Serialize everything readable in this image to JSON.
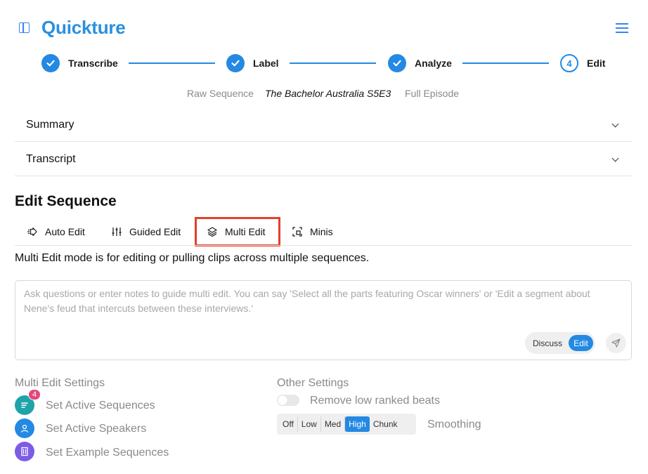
{
  "app": {
    "title": "Quickture"
  },
  "stepper": {
    "steps": [
      {
        "label": "Transcribe",
        "state": "complete"
      },
      {
        "label": "Label",
        "state": "complete"
      },
      {
        "label": "Analyze",
        "state": "complete"
      },
      {
        "label": "Edit",
        "state": "current",
        "number": "4"
      }
    ]
  },
  "breadcrumb": {
    "type": "Raw Sequence",
    "title": "The Bachelor Australia S5E3",
    "scope": "Full Episode"
  },
  "accordions": {
    "summary": "Summary",
    "transcript": "Transcript"
  },
  "edit_sequence": {
    "title": "Edit Sequence",
    "tabs": [
      {
        "label": "Auto Edit",
        "icon": "arrow-right-icon"
      },
      {
        "label": "Guided Edit",
        "icon": "sliders-icon"
      },
      {
        "label": "Multi Edit",
        "icon": "layers-icon",
        "active": true
      },
      {
        "label": "Minis",
        "icon": "crop-icon"
      }
    ],
    "description": "Multi Edit mode is for editing or pulling clips across multiple sequences."
  },
  "notes": {
    "placeholder": "Ask questions or enter notes to guide multi edit. You can say 'Select all the parts featuring Oscar winners' or 'Edit a segment about Nene's feud that intercuts between these interviews.'",
    "value": "",
    "mode_discuss": "Discuss",
    "mode_edit": "Edit",
    "active_mode": "Edit"
  },
  "multi_edit_settings": {
    "title": "Multi Edit Settings",
    "items": [
      {
        "label": "Set Active Sequences",
        "icon": "list-icon",
        "color": "#1fa3a8",
        "badge": "4"
      },
      {
        "label": "Set Active Speakers",
        "icon": "user-icon",
        "color": "#2489e3"
      },
      {
        "label": "Set Example Sequences",
        "icon": "film-icon",
        "color": "#7c5ce6"
      }
    ]
  },
  "other_settings": {
    "title": "Other Settings",
    "remove_low_ranked": {
      "label": "Remove low ranked beats",
      "enabled": false
    },
    "smoothing": {
      "label": "Smoothing",
      "options": [
        "Off",
        "Low",
        "Med",
        "High",
        "Chunk"
      ],
      "selected": "High"
    }
  },
  "colors": {
    "accent": "#2489e3",
    "highlight": "#e0412b",
    "badge": "#e2467b"
  }
}
